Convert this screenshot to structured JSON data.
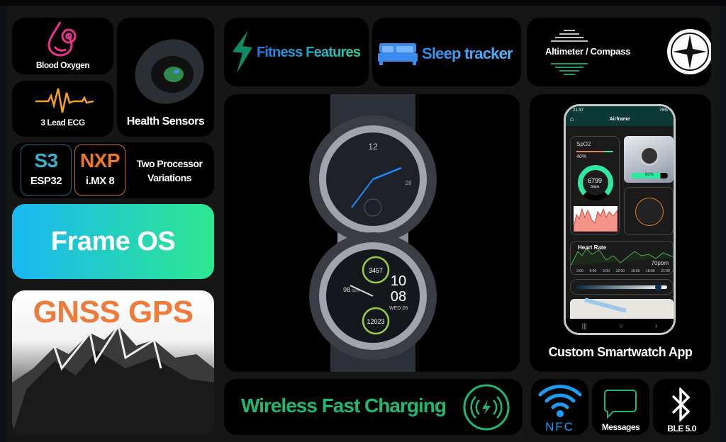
{
  "features": {
    "blood_oxygen": "Blood Oxygen",
    "ecg": "3 Lead ECG",
    "health_sensors": "Health Sensors",
    "processor_s3": "S3",
    "processor_esp": "ESP32",
    "processor_nxp": "NXP",
    "processor_imx": "i.MX 8",
    "two_processor_line1": "Two Processor",
    "two_processor_line2": "Variations",
    "frame_os": "Frame OS",
    "gnss": "GNSS GPS",
    "fitness": "Fitness Features",
    "sleep": "Sleep tracker",
    "altimeter": "Altimeter / Compass",
    "custom_app": "Custom Smartwatch App",
    "wireless": "Wireless Fast Charging",
    "nfc": "NFC",
    "messages": "Messages",
    "ble": "BLE 5.0"
  },
  "watch_top": {
    "hour_12": "12",
    "date": "28"
  },
  "watch_bottom": {
    "steps_top": "3457",
    "bpm": "98",
    "bpm_unit": "bpm",
    "hour": "10",
    "minute": "08",
    "date": "WED 28",
    "steps_bottom": "12023"
  },
  "phone": {
    "status_time": "21:37",
    "status_battery": "78%",
    "app_title": "Airframe",
    "spo2_label": "SpO2",
    "spo2_value": "40%",
    "steps_value": "6799",
    "steps_label": "Steps",
    "battery_value": "80%",
    "heart_rate_title": "Heart Rate",
    "heart_rate_value": "70pbm",
    "hr_axis": [
      "3:00",
      "6:00",
      "9:00",
      "12:00",
      "15:00",
      "18:00",
      "21:00"
    ],
    "slider_level": 0.9
  },
  "colors": {
    "accent_green": "#22c98a",
    "accent_blue": "#1a9cf0",
    "pink": "#e8348c",
    "orange": "#f4a020"
  }
}
